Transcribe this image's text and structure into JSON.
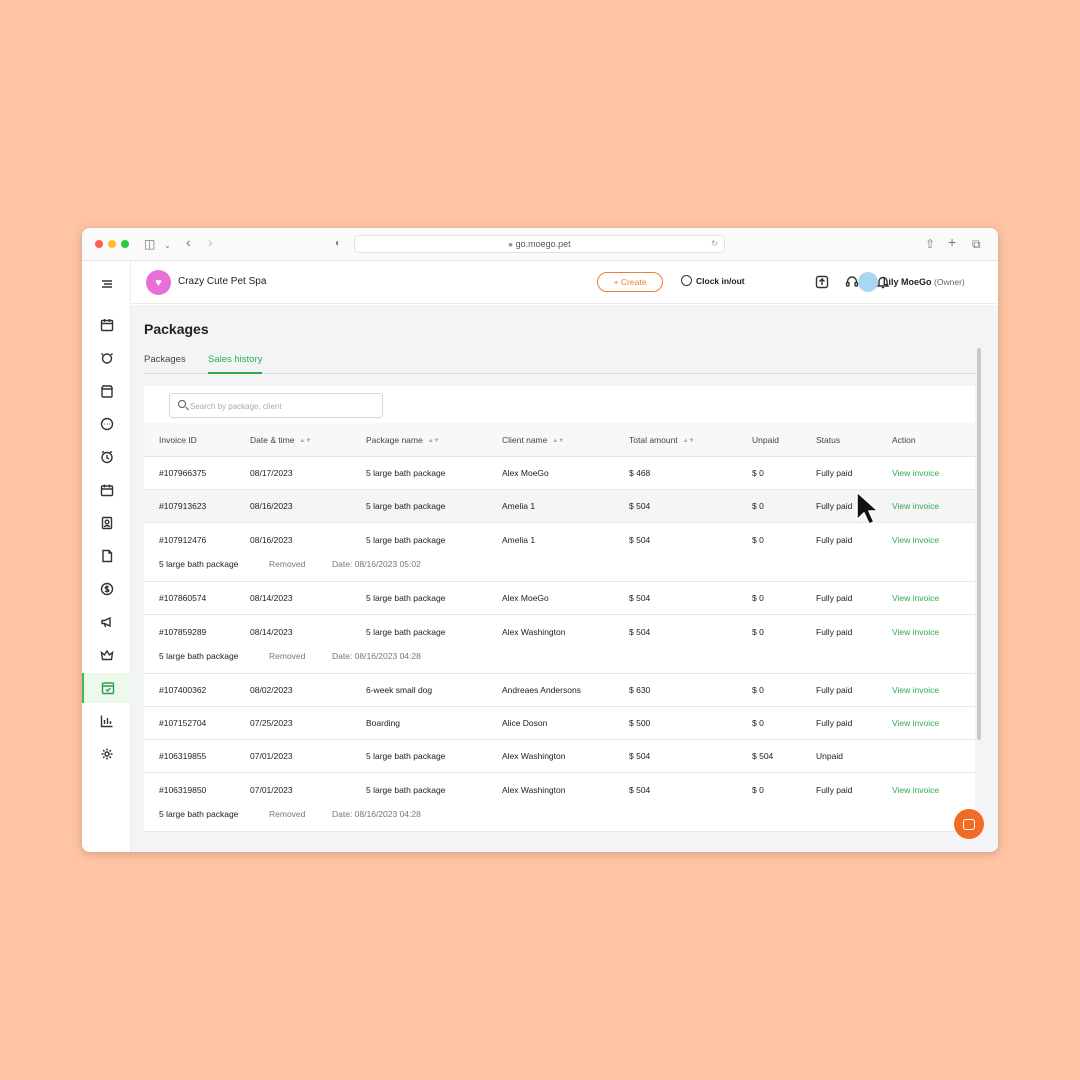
{
  "browser": {
    "url": "go.moego.pet"
  },
  "header": {
    "business_name": "Crazy Cute Pet Spa",
    "create_label": "+ Create",
    "clock_label": "Clock in/out",
    "user_name": "Lily MoeGo",
    "user_role": "(Owner)"
  },
  "sidebar": {
    "items": [
      "menu-icon",
      "calendar-icon",
      "pet-icon",
      "shop-icon",
      "message-icon",
      "reminder-icon",
      "booking-icon",
      "staff-icon",
      "report-icon",
      "payment-icon",
      "marketing-icon",
      "membership-icon",
      "packages-icon",
      "insights-icon",
      "settings-icon"
    ],
    "active": "packages-icon"
  },
  "page": {
    "title": "Packages",
    "tabs": [
      {
        "label": "Packages"
      },
      {
        "label": "Sales history",
        "active": true
      }
    ],
    "search_placeholder": "Search by package, client"
  },
  "table": {
    "columns": [
      "Invoice ID",
      "Date & time",
      "Package name",
      "Client name",
      "Total amount",
      "Unpaid",
      "Status",
      "Action"
    ],
    "rows": [
      {
        "id": "#107966375",
        "date": "08/17/2023",
        "package": "5 large bath package",
        "client": "Alex MoeGo",
        "total": "$ 468",
        "unpaid": "$ 0",
        "status": "Fully paid",
        "action": "View invoice"
      },
      {
        "id": "#107913623",
        "date": "08/16/2023",
        "package": "5 large bath package",
        "client": "Amelia 1",
        "total": "$ 504",
        "unpaid": "$ 0",
        "status": "Fully paid",
        "action": "View invoice"
      },
      {
        "id": "#107912476",
        "date": "08/16/2023",
        "package": "5 large bath package",
        "client": "Amelia 1",
        "total": "$ 504",
        "unpaid": "$ 0",
        "status": "Fully paid",
        "action": "View invoice",
        "detail": {
          "package": "5 large bath package",
          "state": "Removed",
          "date": "Date: 08/16/2023 05:02"
        }
      },
      {
        "id": "#107860574",
        "date": "08/14/2023",
        "package": "5 large bath package",
        "client": "Alex MoeGo",
        "total": "$ 504",
        "unpaid": "$ 0",
        "status": "Fully paid",
        "action": "View invoice"
      },
      {
        "id": "#107859289",
        "date": "08/14/2023",
        "package": "5 large bath package",
        "client": "Alex Washington",
        "total": "$ 504",
        "unpaid": "$ 0",
        "status": "Fully paid",
        "action": "View invoice",
        "detail": {
          "package": "5 large bath package",
          "state": "Removed",
          "date": "Date: 08/16/2023 04:28"
        }
      },
      {
        "id": "#107400362",
        "date": "08/02/2023",
        "package": "6-week small dog",
        "client": "Andreaes Andersons",
        "total": "$ 630",
        "unpaid": "$ 0",
        "status": "Fully paid",
        "action": "View invoice"
      },
      {
        "id": "#107152704",
        "date": "07/25/2023",
        "package": "Boarding",
        "client": "Alice Doson",
        "total": "$ 500",
        "unpaid": "$ 0",
        "status": "Fully paid",
        "action": "View invoice"
      },
      {
        "id": "#106319855",
        "date": "07/01/2023",
        "package": "5 large bath package",
        "client": "Alex Washington",
        "total": "$ 504",
        "unpaid": "$ 504",
        "status": "Unpaid",
        "action": ""
      },
      {
        "id": "#106319850",
        "date": "07/01/2023",
        "package": "5 large bath package",
        "client": "Alex Washington",
        "total": "$ 504",
        "unpaid": "$ 0",
        "status": "Fully paid",
        "action": "View invoice",
        "detail": {
          "package": "5 large bath package",
          "state": "Removed",
          "date": "Date: 08/16/2023 04:28"
        }
      }
    ]
  },
  "colors": {
    "accent": "#2eab50",
    "brand": "#f07c3b",
    "background": "#ffc4a3"
  }
}
